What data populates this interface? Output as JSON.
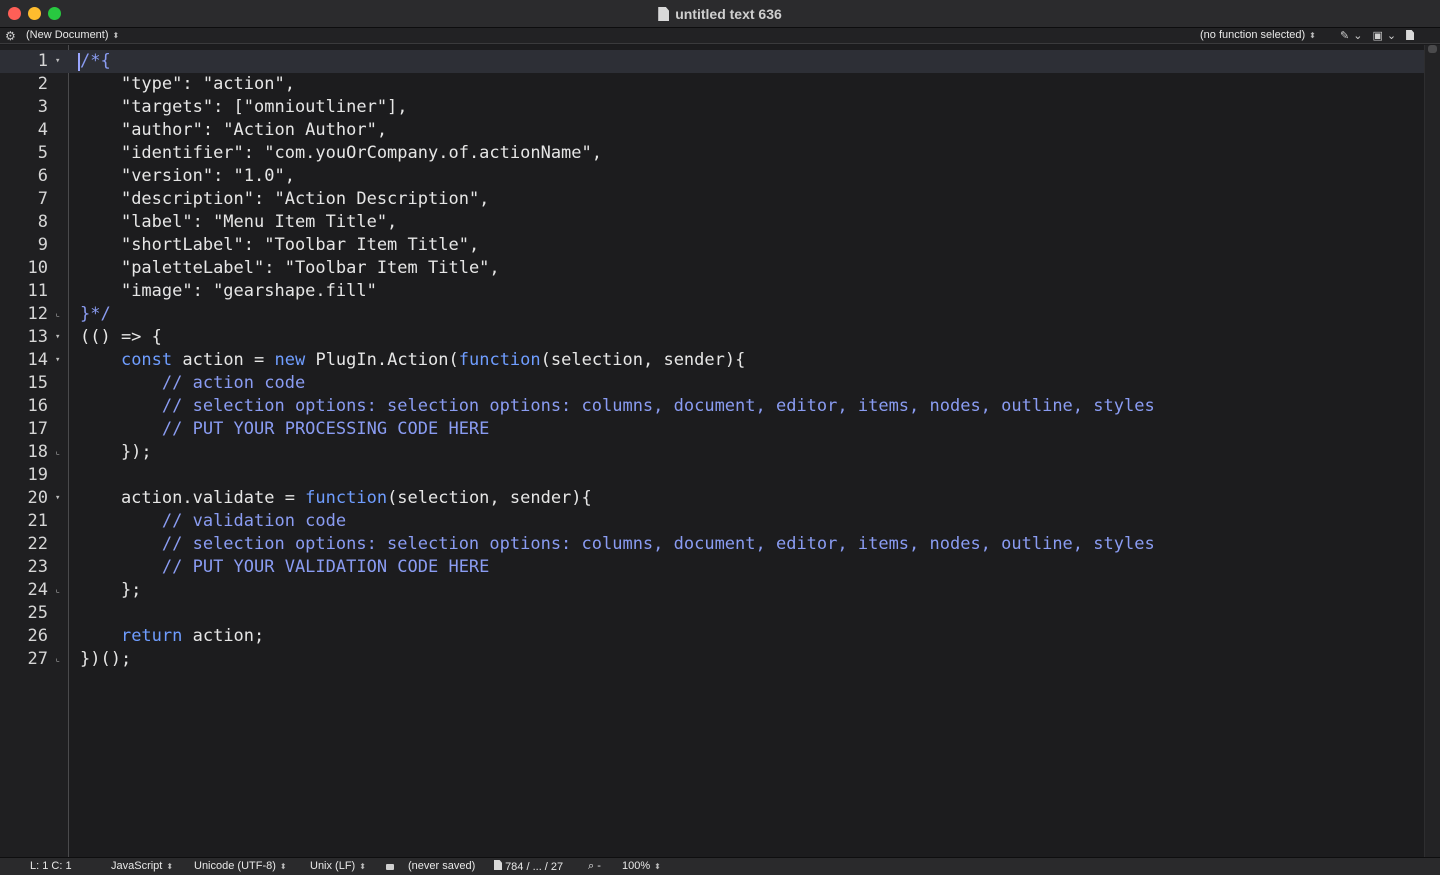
{
  "window": {
    "title": "untitled text 636"
  },
  "navbar": {
    "document_menu": "(New Document)",
    "function_menu": "(no function selected)"
  },
  "editor": {
    "current_line": 1,
    "lines": [
      {
        "n": "1",
        "fold": "▾",
        "tokens": [
          [
            "cm",
            "/*{"
          ]
        ]
      },
      {
        "n": "2",
        "fold": "",
        "tokens": [
          [
            "cm",
            "    "
          ],
          [
            "str",
            "\"type\": \"action\","
          ]
        ]
      },
      {
        "n": "3",
        "fold": "",
        "tokens": [
          [
            "cm",
            "    "
          ],
          [
            "str",
            "\"targets\": [\"omnioutliner\"],"
          ]
        ]
      },
      {
        "n": "4",
        "fold": "",
        "tokens": [
          [
            "cm",
            "    "
          ],
          [
            "str",
            "\"author\": \"Action Author\","
          ]
        ]
      },
      {
        "n": "5",
        "fold": "",
        "tokens": [
          [
            "cm",
            "    "
          ],
          [
            "str",
            "\"identifier\": \"com.youOrCompany.of.actionName\","
          ]
        ]
      },
      {
        "n": "6",
        "fold": "",
        "tokens": [
          [
            "cm",
            "    "
          ],
          [
            "str",
            "\"version\": \"1.0\","
          ]
        ]
      },
      {
        "n": "7",
        "fold": "",
        "tokens": [
          [
            "cm",
            "    "
          ],
          [
            "str",
            "\"description\": \"Action Description\","
          ]
        ]
      },
      {
        "n": "8",
        "fold": "",
        "tokens": [
          [
            "cm",
            "    "
          ],
          [
            "str",
            "\"label\": \"Menu Item Title\","
          ]
        ]
      },
      {
        "n": "9",
        "fold": "",
        "tokens": [
          [
            "cm",
            "    "
          ],
          [
            "str",
            "\"shortLabel\": \"Toolbar Item Title\","
          ]
        ]
      },
      {
        "n": "10",
        "fold": "",
        "tokens": [
          [
            "cm",
            "    "
          ],
          [
            "str",
            "\"paletteLabel\": \"Toolbar Item Title\","
          ]
        ]
      },
      {
        "n": "11",
        "fold": "",
        "tokens": [
          [
            "cm",
            "    "
          ],
          [
            "str",
            "\"image\": \"gearshape.fill\""
          ]
        ]
      },
      {
        "n": "12",
        "fold": "⌞",
        "tokens": [
          [
            "cm",
            "}*/"
          ]
        ]
      },
      {
        "n": "13",
        "fold": "▾",
        "tokens": [
          [
            "txt",
            "(() => {"
          ]
        ]
      },
      {
        "n": "14",
        "fold": "▾",
        "tokens": [
          [
            "txt",
            "    "
          ],
          [
            "kw",
            "const"
          ],
          [
            "txt",
            " action = "
          ],
          [
            "kw",
            "new"
          ],
          [
            "txt",
            " PlugIn.Action("
          ],
          [
            "kw",
            "function"
          ],
          [
            "txt",
            "(selection, sender){"
          ]
        ]
      },
      {
        "n": "15",
        "fold": "",
        "tokens": [
          [
            "txt",
            "        "
          ],
          [
            "cm",
            "// action code"
          ]
        ]
      },
      {
        "n": "16",
        "fold": "",
        "tokens": [
          [
            "txt",
            "        "
          ],
          [
            "cm",
            "// selection options: selection options: columns, document, editor, items, nodes, outline, styles"
          ]
        ]
      },
      {
        "n": "17",
        "fold": "",
        "tokens": [
          [
            "txt",
            "        "
          ],
          [
            "cm",
            "// PUT YOUR PROCESSING CODE HERE"
          ]
        ]
      },
      {
        "n": "18",
        "fold": "⌞",
        "tokens": [
          [
            "txt",
            "    });"
          ]
        ]
      },
      {
        "n": "19",
        "fold": "",
        "tokens": []
      },
      {
        "n": "20",
        "fold": "▾",
        "tokens": [
          [
            "txt",
            "    action.validate = "
          ],
          [
            "kw",
            "function"
          ],
          [
            "txt",
            "(selection, sender){"
          ]
        ]
      },
      {
        "n": "21",
        "fold": "",
        "tokens": [
          [
            "txt",
            "        "
          ],
          [
            "cm",
            "// validation code"
          ]
        ]
      },
      {
        "n": "22",
        "fold": "",
        "tokens": [
          [
            "txt",
            "        "
          ],
          [
            "cm",
            "// selection options: selection options: columns, document, editor, items, nodes, outline, styles"
          ]
        ]
      },
      {
        "n": "23",
        "fold": "",
        "tokens": [
          [
            "txt",
            "        "
          ],
          [
            "cm",
            "// PUT YOUR VALIDATION CODE HERE"
          ]
        ]
      },
      {
        "n": "24",
        "fold": "⌞",
        "tokens": [
          [
            "txt",
            "    };"
          ]
        ]
      },
      {
        "n": "25",
        "fold": "",
        "tokens": []
      },
      {
        "n": "26",
        "fold": "",
        "tokens": [
          [
            "txt",
            "    "
          ],
          [
            "kw",
            "return"
          ],
          [
            "txt",
            " action;"
          ]
        ]
      },
      {
        "n": "27",
        "fold": "⌞",
        "tokens": [
          [
            "txt",
            "})();"
          ]
        ]
      }
    ]
  },
  "statusbar": {
    "position": "L: 1 C: 1",
    "language": "JavaScript",
    "encoding": "Unicode (UTF-8)",
    "line_endings": "Unix (LF)",
    "save_state": "(never saved)",
    "doc_stats": "784 / ... / 27",
    "zoom_minus": "-",
    "zoom": "100%"
  },
  "colors": {
    "comment": "#8a9cf2",
    "keyword": "#6f9dff",
    "text": "#e6e6e6",
    "background": "#1c1c1e"
  }
}
